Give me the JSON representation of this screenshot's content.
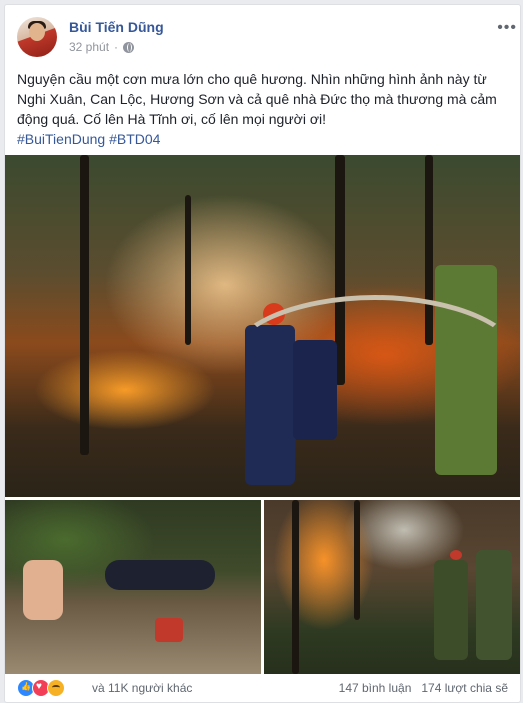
{
  "post": {
    "author": "Bùi Tiến Dũng",
    "time": "32 phút",
    "privacy_icon": "globe-icon",
    "more_icon": "more-icon",
    "text_line1": "Nguyện cầu một cơn mưa lớn cho quê hương. Nhìn những hình ảnh này từ Nghi Xuân, Can Lộc, Hương Sơn và cả quê nhà Đức thọ mà thương mà cảm động quá. Cố lên Hà Tĩnh ơi, cố lên mọi người ơi!",
    "hashtags": [
      "#BuiTienDung",
      "#BTD04"
    ]
  },
  "photos": {
    "main": "forest-fire-firefighters",
    "left": "resting-firefighters",
    "right": "soldiers-fighting-fire"
  },
  "footer": {
    "reactions": [
      "like-icon",
      "love-icon",
      "sad-icon"
    ],
    "reaction_text": "và 11K người khác",
    "comments": "147 bình luận",
    "shares": "174 lượt chia sẽ"
  },
  "colors": {
    "link": "#365899",
    "text": "#1d2129",
    "meta": "#90949c",
    "background": "#e9ebee"
  }
}
